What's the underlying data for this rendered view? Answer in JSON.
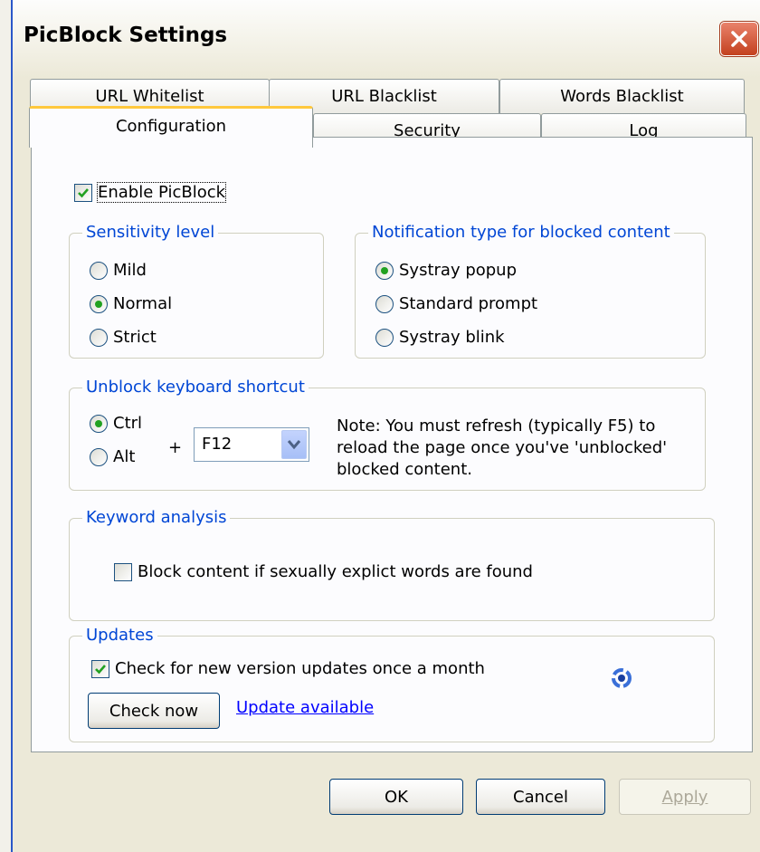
{
  "window": {
    "title": "PicBlock Settings"
  },
  "tabs_back": [
    "URL Whitelist",
    "URL Blacklist",
    "Words Blacklist"
  ],
  "tabs_front": [
    "Configuration",
    "Security",
    "Log"
  ],
  "enable": {
    "label": "Enable PicBlock",
    "checked": true
  },
  "sensitivity": {
    "legend": "Sensitivity level",
    "options": [
      "Mild",
      "Normal",
      "Strict"
    ],
    "selected": "Normal"
  },
  "notification": {
    "legend": "Notification type for blocked content",
    "options": [
      "Systray popup",
      "Standard prompt",
      "Systray blink"
    ],
    "selected": "Systray popup"
  },
  "shortcut": {
    "legend": "Unblock keyboard shortcut",
    "modifiers": [
      "Ctrl",
      "Alt"
    ],
    "selected": "Ctrl",
    "plus": "+",
    "key": "F12",
    "note_lines": [
      "Note: You must refresh (typically F5) to",
      "reload the page once you've 'unblocked'",
      "blocked content."
    ]
  },
  "keyword": {
    "legend": "Keyword analysis",
    "label": "Block content if sexually explict words are found",
    "checked": false
  },
  "updates": {
    "legend": "Updates",
    "check_label": "Check for new version updates once a month",
    "checked": true,
    "check_now": "Check now",
    "link": "Update available"
  },
  "buttons": {
    "ok": "OK",
    "cancel": "Cancel",
    "apply": "Apply"
  },
  "colors": {
    "legend": "#0046d5",
    "link": "#0000ff",
    "radio_dot": "#21a121",
    "check": "#21a121"
  },
  "icons": {
    "close": "close-icon",
    "update_status": "refresh-icon",
    "dropdown": "chevron-down-icon",
    "check": "checkmark-icon"
  }
}
